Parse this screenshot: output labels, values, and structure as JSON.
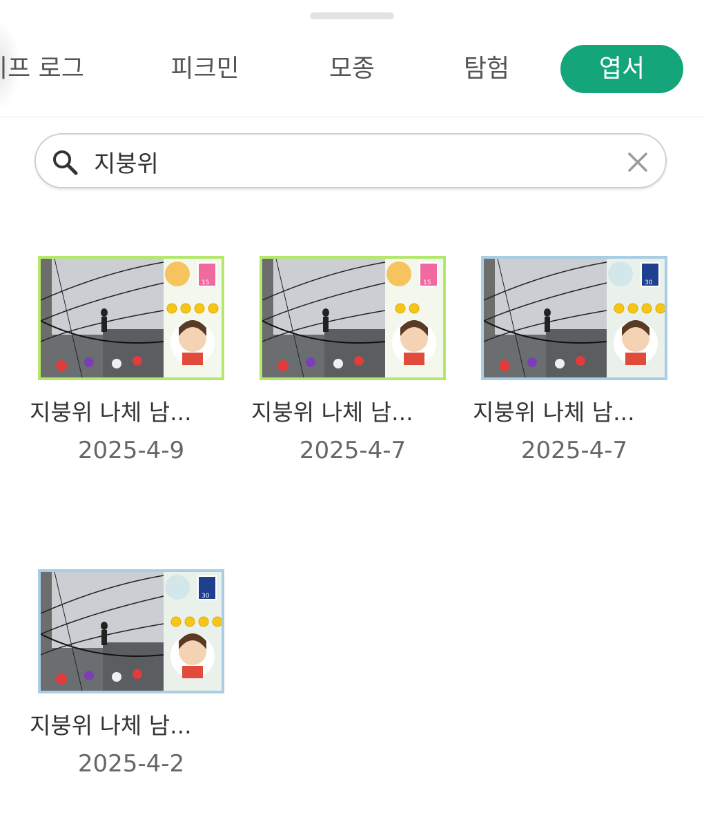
{
  "tabs": [
    {
      "label": "라이프 로그",
      "shown": "이프 로그",
      "active": false
    },
    {
      "label": "피크민",
      "active": false
    },
    {
      "label": "모종",
      "active": false
    },
    {
      "label": "탐험",
      "active": false
    },
    {
      "label": "엽서",
      "active": true
    }
  ],
  "search": {
    "value": "지붕위",
    "icon": "search-icon",
    "clear_icon": "close-icon"
  },
  "postcards": [
    {
      "title": "지붕위 나체 남...",
      "date": "2025-4-9",
      "frame": "green",
      "stamp": "15",
      "stars": 4
    },
    {
      "title": "지붕위 나체 남...",
      "date": "2025-4-7",
      "frame": "green",
      "stamp": "15",
      "stars": 2
    },
    {
      "title": "지붕위 나체 남...",
      "date": "2025-4-7",
      "frame": "blue",
      "stamp": "30",
      "stars": 4
    },
    {
      "title": "지붕위 나체 남...",
      "date": "2025-4-2",
      "frame": "blue",
      "stamp": "30",
      "stars": 4
    }
  ],
  "colors": {
    "accent": "#14a57a",
    "frame_green": "#b4e86a",
    "frame_blue": "#a9cde3"
  }
}
